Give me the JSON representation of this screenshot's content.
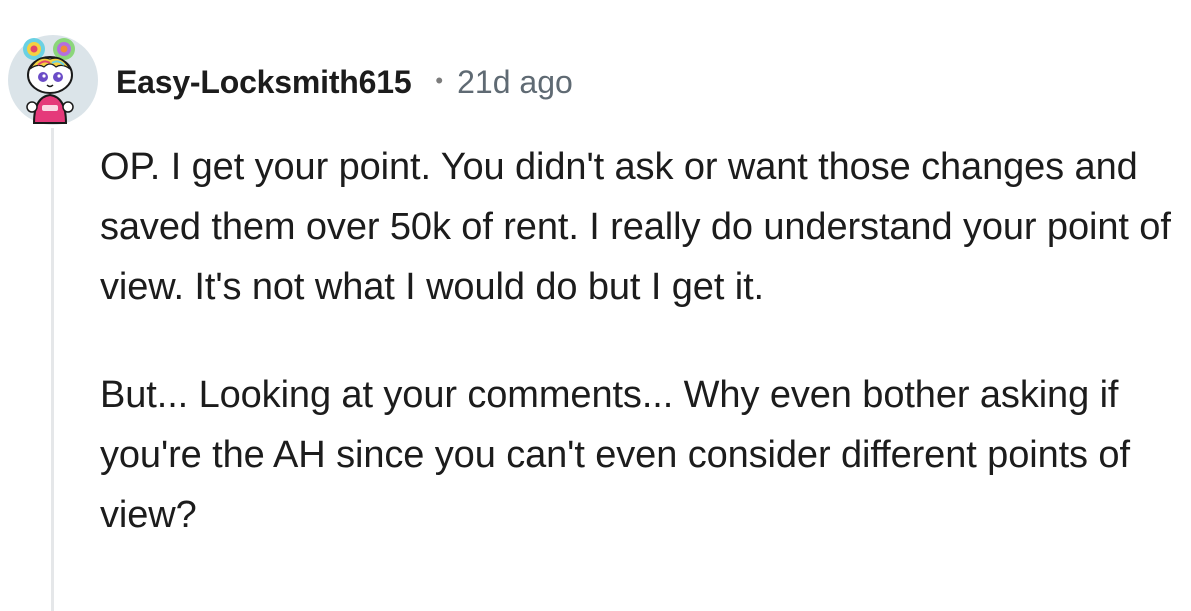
{
  "comment": {
    "avatar_icon": "reddit-snoo-avatar-icon",
    "author": "Easy-Locksmith615",
    "separator": "•",
    "timestamp": "21d ago",
    "paragraphs": [
      "OP. I get your point. You didn't ask or want those changes and saved them over 50k of rent. I really do understand your point of view. It's not what I would do but I get it.",
      "But... Looking at your comments... Why even bother asking if you're the AH since you can't even consider different points of view?"
    ]
  },
  "colors": {
    "thread_line": "#e5e7e9",
    "timestamp": "#5f6a73",
    "avatar_bg": "#dbe4e9"
  }
}
